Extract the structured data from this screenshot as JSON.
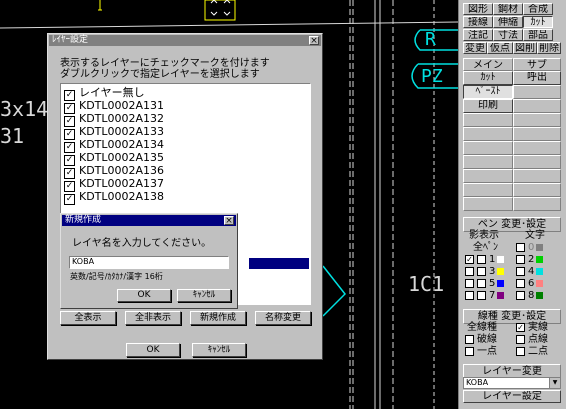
{
  "colors": {
    "dialog_face": "#c0c0c0",
    "title_active": "#000080",
    "title_inactive": "#808080",
    "canvas_bg": "#000000",
    "cad_line": "#d8d8d8",
    "cad_highlight": "#00ffff"
  },
  "cad": {
    "left_text_1": "3x14",
    "left_text_2": "31",
    "right_label": "1C1",
    "circle_label_1": "R",
    "circle_label_2": "PZ"
  },
  "palette": {
    "rows": [
      [
        "図形",
        "鋼材",
        "合成"
      ],
      [
        "接線",
        "伸縮",
        "ｶｯﾄ"
      ],
      [
        "注記",
        "寸法",
        "部品"
      ],
      [
        "変更",
        "仮点",
        "図削",
        "削除"
      ]
    ],
    "main_header": "メイン",
    "sub_header": "サブ",
    "main_items": [
      "ｶｯﾄ",
      "ﾍﾟｰｽﾄ",
      "印刷"
    ],
    "sub_items": [
      "呼出"
    ],
    "pen_header": "ペン 変更･設定",
    "pen_col1": "影表示",
    "pen_col2": "文字",
    "pen_all": "全ﾍﾟﾝ",
    "pen_rows": [
      {
        "left_checked": true,
        "num1": "1",
        "c1": "#ffffff",
        "num2": "2",
        "c2": "#00d000"
      },
      {
        "left_checked": false,
        "num1": "3",
        "c1": "#ffff00",
        "num2": "4",
        "c2": "#00e0e0"
      },
      {
        "left_checked": false,
        "num1": "5",
        "c1": "#0000ff",
        "num2": "6",
        "c2": "#ff8080"
      },
      {
        "left_checked": false,
        "num1": "7",
        "c1": "#800080",
        "num2": "8",
        "c2": "#008000"
      }
    ],
    "pen_zero": "0",
    "pen_zero_color": "#808080",
    "linetype_header": "線種 変更･設定",
    "linetype_rows": [
      [
        "全線種",
        "実線"
      ],
      [
        "破線",
        "点線"
      ],
      [
        "一点",
        "二点"
      ]
    ],
    "layer_change_header": "レイヤー変更",
    "layer_current": "KOBA",
    "layer_setting": "レイヤー設定"
  },
  "layer_dialog": {
    "title": "ﾚｲﾔｰ設定",
    "instructions_1": "表示するレイヤーにチェックマークを付けます",
    "instructions_2": "ダブルクリックで指定レイヤーを選択します",
    "items": [
      "レイヤー無し",
      "KDTL0002A131",
      "KDTL0002A132",
      "KDTL0002A133",
      "KDTL0002A134",
      "KDTL0002A135",
      "KDTL0002A136",
      "KDTL0002A137",
      "KDTL0002A138"
    ],
    "buttons": [
      "全表示",
      "全非表示",
      "新規作成",
      "名称変更"
    ],
    "ok": "OK",
    "cancel": "ｷｬﾝｾﾙ"
  },
  "new_dialog": {
    "title": "新規作成",
    "prompt": "レイヤ名を入力してください。",
    "value": "KOBA",
    "hint": "英数/記号/ｶﾀｶﾅ/漢字 16桁",
    "ok": "OK",
    "cancel": "ｷｬﾝｾﾙ"
  }
}
